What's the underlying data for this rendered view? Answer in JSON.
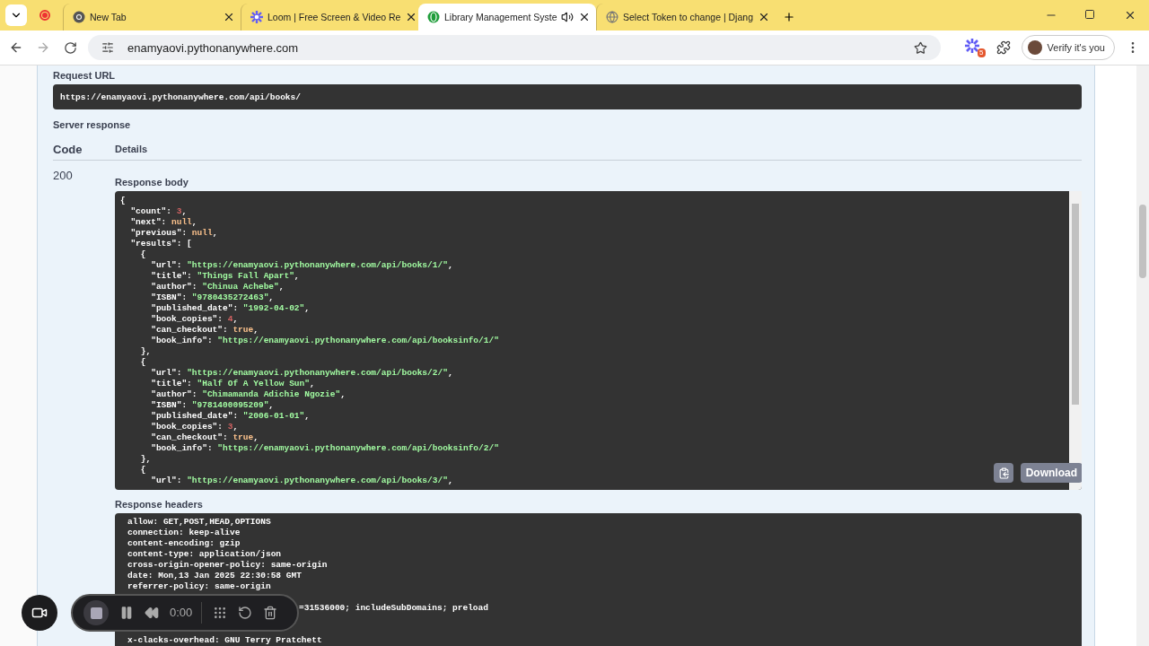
{
  "browser": {
    "tabs": [
      {
        "title": "New Tab",
        "selected": false,
        "audio": false
      },
      {
        "title": "Loom | Free Screen & Video Re",
        "selected": false,
        "audio": false
      },
      {
        "title": "Library Management Syste",
        "selected": true,
        "audio": true
      },
      {
        "title": "Select Token to change | Djang",
        "selected": false,
        "audio": false
      }
    ],
    "address": "enamyaovi.pythonanywhere.com",
    "extension_badge": "5",
    "profile_label": "Verify it's you"
  },
  "request_url": {
    "label": "Request URL",
    "value": "https://enamyaovi.pythonanywhere.com/api/books/"
  },
  "server_response": {
    "label": "Server response",
    "columns": [
      "Code",
      "Details"
    ],
    "code": "200",
    "body_label": "Response body",
    "body_lines": [
      [
        {
          "kind": "punct",
          "t": "{"
        }
      ],
      [
        {
          "kind": "key",
          "t": "  \"count\": "
        },
        {
          "kind": "number",
          "t": "3"
        },
        {
          "kind": "punct",
          "t": ","
        }
      ],
      [
        {
          "kind": "key",
          "t": "  \"next\": "
        },
        {
          "kind": "literal",
          "t": "null"
        },
        {
          "kind": "punct",
          "t": ","
        }
      ],
      [
        {
          "kind": "key",
          "t": "  \"previous\": "
        },
        {
          "kind": "literal",
          "t": "null"
        },
        {
          "kind": "punct",
          "t": ","
        }
      ],
      [
        {
          "kind": "key",
          "t": "  \"results\": ["
        }
      ],
      [
        {
          "kind": "punct",
          "t": "    {"
        }
      ],
      [
        {
          "kind": "key",
          "t": "      \"url\": "
        },
        {
          "kind": "string",
          "t": "\"https://enamyaovi.pythonanywhere.com/api/books/1/\""
        },
        {
          "kind": "punct",
          "t": ","
        }
      ],
      [
        {
          "kind": "key",
          "t": "      \"title\": "
        },
        {
          "kind": "string",
          "t": "\"Things Fall Apart\""
        },
        {
          "kind": "punct",
          "t": ","
        }
      ],
      [
        {
          "kind": "key",
          "t": "      \"author\": "
        },
        {
          "kind": "string",
          "t": "\"Chinua Achebe\""
        },
        {
          "kind": "punct",
          "t": ","
        }
      ],
      [
        {
          "kind": "key",
          "t": "      \"ISBN\": "
        },
        {
          "kind": "string",
          "t": "\"9780435272463\""
        },
        {
          "kind": "punct",
          "t": ","
        }
      ],
      [
        {
          "kind": "key",
          "t": "      \"published_date\": "
        },
        {
          "kind": "string",
          "t": "\"1992-04-02\""
        },
        {
          "kind": "punct",
          "t": ","
        }
      ],
      [
        {
          "kind": "key",
          "t": "      \"book_copies\": "
        },
        {
          "kind": "number",
          "t": "4"
        },
        {
          "kind": "punct",
          "t": ","
        }
      ],
      [
        {
          "kind": "key",
          "t": "      \"can_checkout\": "
        },
        {
          "kind": "literal",
          "t": "true"
        },
        {
          "kind": "punct",
          "t": ","
        }
      ],
      [
        {
          "kind": "key",
          "t": "      \"book_info\": "
        },
        {
          "kind": "string",
          "t": "\"https://enamyaovi.pythonanywhere.com/api/booksinfo/1/\""
        }
      ],
      [
        {
          "kind": "punct",
          "t": "    },"
        }
      ],
      [
        {
          "kind": "punct",
          "t": "    {"
        }
      ],
      [
        {
          "kind": "key",
          "t": "      \"url\": "
        },
        {
          "kind": "string",
          "t": "\"https://enamyaovi.pythonanywhere.com/api/books/2/\""
        },
        {
          "kind": "punct",
          "t": ","
        }
      ],
      [
        {
          "kind": "key",
          "t": "      \"title\": "
        },
        {
          "kind": "string",
          "t": "\"Half Of A Yellow Sun\""
        },
        {
          "kind": "punct",
          "t": ","
        }
      ],
      [
        {
          "kind": "key",
          "t": "      \"author\": "
        },
        {
          "kind": "string",
          "t": "\"Chimamanda Adichie Ngozie\""
        },
        {
          "kind": "punct",
          "t": ","
        }
      ],
      [
        {
          "kind": "key",
          "t": "      \"ISBN\": "
        },
        {
          "kind": "string",
          "t": "\"9781400095209\""
        },
        {
          "kind": "punct",
          "t": ","
        }
      ],
      [
        {
          "kind": "key",
          "t": "      \"published_date\": "
        },
        {
          "kind": "string",
          "t": "\"2006-01-01\""
        },
        {
          "kind": "punct",
          "t": ","
        }
      ],
      [
        {
          "kind": "key",
          "t": "      \"book_copies\": "
        },
        {
          "kind": "number",
          "t": "3"
        },
        {
          "kind": "punct",
          "t": ","
        }
      ],
      [
        {
          "kind": "key",
          "t": "      \"can_checkout\": "
        },
        {
          "kind": "literal",
          "t": "true"
        },
        {
          "kind": "punct",
          "t": ","
        }
      ],
      [
        {
          "kind": "key",
          "t": "      \"book_info\": "
        },
        {
          "kind": "string",
          "t": "\"https://enamyaovi.pythonanywhere.com/api/booksinfo/2/\""
        }
      ],
      [
        {
          "kind": "punct",
          "t": "    },"
        }
      ],
      [
        {
          "kind": "punct",
          "t": "    {"
        }
      ],
      [
        {
          "kind": "key",
          "t": "      \"url\": "
        },
        {
          "kind": "string",
          "t": "\"https://enamyaovi.pythonanywhere.com/api/books/3/\""
        },
        {
          "kind": "punct",
          "t": ","
        }
      ]
    ],
    "download_label": "Download",
    "headers_label": "Response headers",
    "header_lines": [
      {
        "kind": "line",
        "text": "allow: GET,POST,HEAD,OPTIONS"
      },
      {
        "kind": "line",
        "text": "connection: keep-alive"
      },
      {
        "kind": "line",
        "text": "content-encoding: gzip"
      },
      {
        "kind": "line",
        "text": "content-type: application/json"
      },
      {
        "kind": "line",
        "text": "cross-origin-opener-policy: same-origin"
      },
      {
        "kind": "line",
        "text": "date: Mon,13 Jan 2025 22:30:58 GMT"
      },
      {
        "kind": "line",
        "text": "referrer-policy: same-origin"
      },
      {
        "kind": "hidden"
      },
      {
        "kind": "tail",
        "text": "=31536000; includeSubDomains; preload"
      },
      {
        "kind": "hidden"
      },
      {
        "kind": "hidden"
      },
      {
        "kind": "line",
        "text": "x-clacks-overhead: GNU Terry Pratchett"
      }
    ]
  },
  "recorder": {
    "time": "0:00"
  }
}
